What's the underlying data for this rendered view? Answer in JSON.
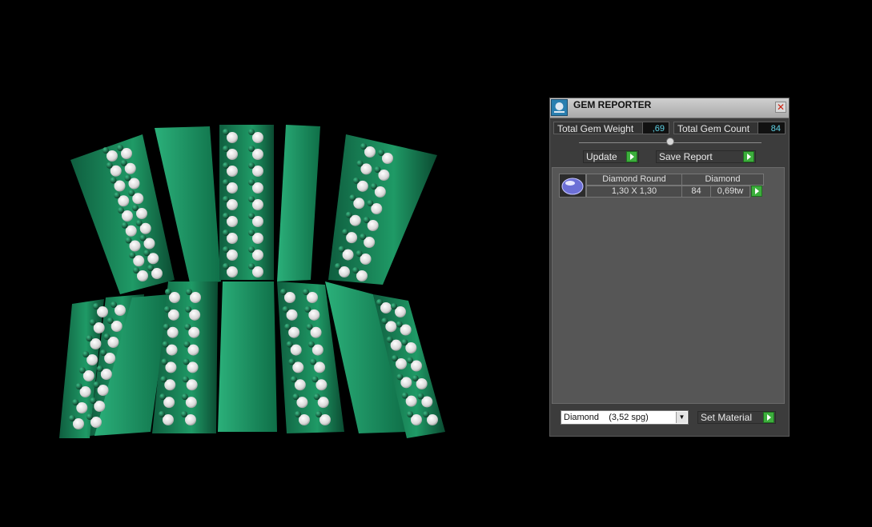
{
  "panel": {
    "title": "GEM REPORTER",
    "close_glyph": "✕",
    "total_weight_label": "Total Gem Weight",
    "total_weight_value": ",69",
    "total_count_label": "Total Gem Count",
    "total_count_value": "84",
    "slider_level": 0.5,
    "update_label": "Update",
    "save_report_label": "Save Report",
    "table": {
      "shape_header": "Diamond Round",
      "material_header": "Diamond",
      "rows": [
        {
          "size": "1,30 X 1,30",
          "count": "84",
          "weight": "0,69tw"
        }
      ]
    },
    "material_select_value": "Diamond    (3,52 spg)",
    "set_material_label": "Set Material"
  },
  "icons": {
    "app": "gem-reporter-icon",
    "close": "close-icon",
    "go": "green-play-icon",
    "gem": "round-diamond-icon",
    "dropdown": "chevron-down-icon"
  },
  "colors": {
    "background": "#000000",
    "model_green": "#1b8a5c",
    "value_text": "#5fd3e6",
    "go_button": "#3cae3c"
  }
}
